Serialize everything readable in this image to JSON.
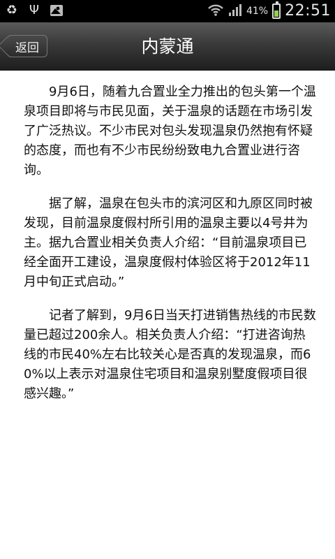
{
  "status_bar": {
    "icons": [
      "recycle-icon",
      "usb-icon",
      "image-icon"
    ],
    "battery_percent": "41%",
    "time": "22:51"
  },
  "header": {
    "back_label": "返回",
    "title": "内蒙通"
  },
  "article": {
    "paragraphs": [
      "9月6日，随着九合置业全力推出的包头第一个温泉项目即将与市民见面，关于温泉的话题在市场引发了广泛热议。不少市民对包头发现温泉仍然抱有怀疑的态度，而也有不少市民纷纷致电九合置业进行咨询。",
      "据了解，温泉在包头市的滨河区和九原区同时被发现，目前温泉度假村所引用的温泉主要以4号井为主。据九合置业相关负责人介绍：“目前温泉项目已经全面开工建设，温泉度假村体验区将于2012年11月中旬正式启动。”",
      "记者了解到，9月6日当天打进销售热线的市民数量已超过200余人。相关负责人介绍：“打进咨询热线的市民40%左右比较关心是否真的发现温泉，而60%以上表示对温泉住宅项目和温泉别墅度假项目很感兴趣。”"
    ]
  }
}
